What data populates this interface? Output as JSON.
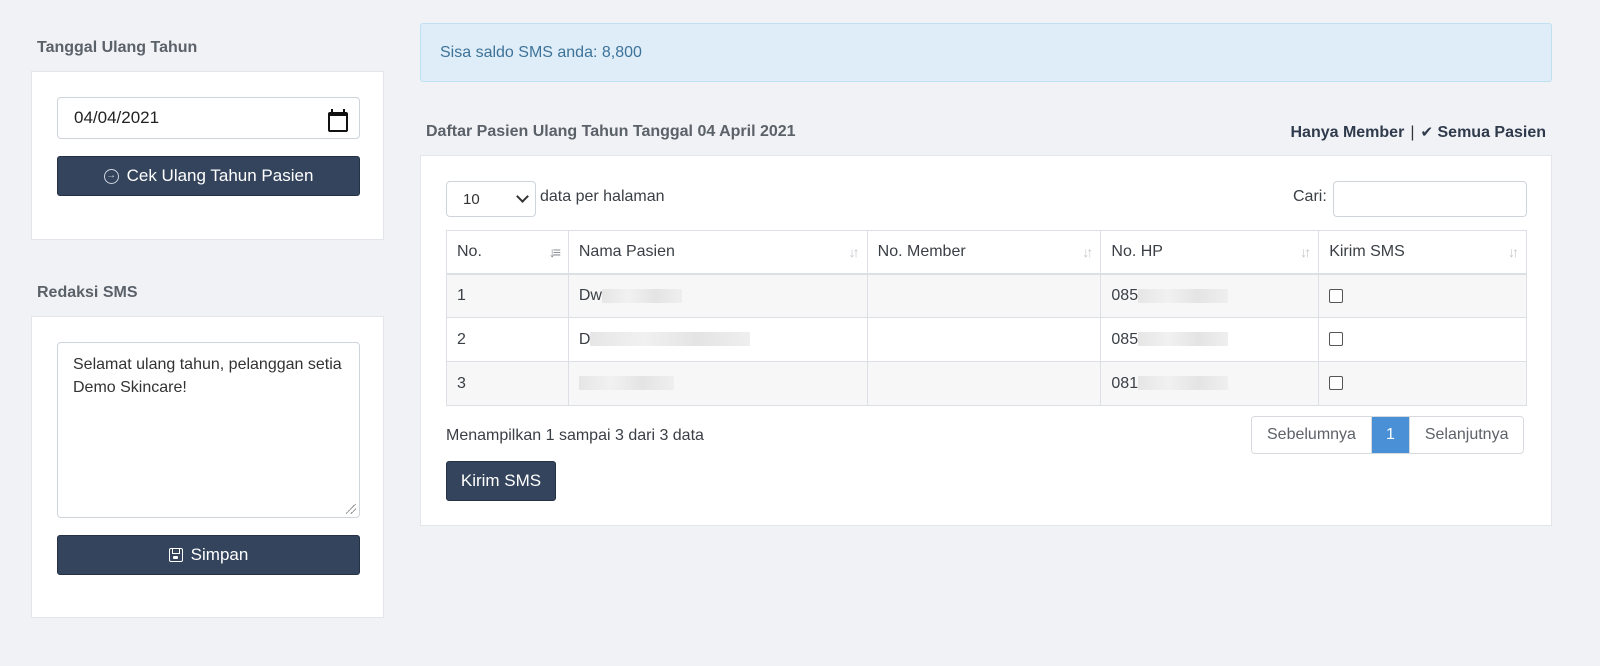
{
  "birthday_section": {
    "title": "Tanggal Ulang Tahun",
    "date_value": "04/04/2021",
    "check_button_label": "Cek Ulang Tahun Pasien"
  },
  "sms_section": {
    "title": "Redaksi SMS",
    "message": "Selamat ulang tahun, pelanggan setia Demo Skincare!",
    "save_button_label": "Simpan"
  },
  "alert": {
    "text": "Sisa saldo SMS anda: 8,800"
  },
  "list": {
    "title": "Daftar Pasien Ulang Tahun Tanggal 04 April 2021",
    "filter_member": "Hanya Member",
    "filter_separator": "|",
    "filter_all": "Semua Pasien"
  },
  "table": {
    "page_length": "10",
    "page_length_label": "data per halaman",
    "search_label": "Cari:",
    "columns": [
      "No.",
      "Nama Pasien",
      "No. Member",
      "No. HP",
      "Kirim SMS"
    ],
    "rows": [
      {
        "no": "1",
        "name": "Dw",
        "member": "",
        "phone": "085"
      },
      {
        "no": "2",
        "name": "D",
        "member": "",
        "phone": "085"
      },
      {
        "no": "3",
        "name": "",
        "member": "",
        "phone": "081"
      }
    ],
    "info": "Menampilkan 1 sampai 3 dari 3 data",
    "pager": {
      "prev": "Sebelumnya",
      "current": "1",
      "next": "Selanjutnya"
    },
    "send_button_label": "Kirim SMS"
  },
  "colors": {
    "primary_dark": "#34445c",
    "alert_bg": "#deedf7",
    "pager_active": "#4a90d6"
  }
}
